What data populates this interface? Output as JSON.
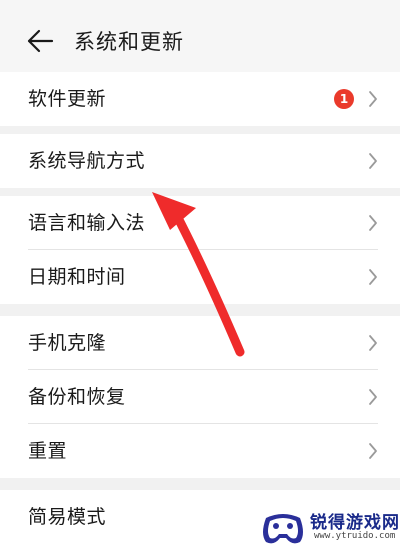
{
  "header": {
    "title": "系统和更新",
    "back_icon": "back-arrow-icon"
  },
  "groups": [
    {
      "items": [
        {
          "label": "软件更新",
          "badge": "1"
        }
      ]
    },
    {
      "items": [
        {
          "label": "系统导航方式"
        }
      ]
    },
    {
      "items": [
        {
          "label": "语言和输入法"
        },
        {
          "label": "日期和时间"
        }
      ]
    },
    {
      "items": [
        {
          "label": "手机克隆"
        },
        {
          "label": "备份和恢复"
        },
        {
          "label": "重置"
        }
      ]
    },
    {
      "items": [
        {
          "label": "简易模式"
        }
      ]
    }
  ],
  "annotation": {
    "color": "#ef2b2b"
  },
  "watermark": {
    "name": "锐得游戏网",
    "url": "www.ytruido.com"
  },
  "colors": {
    "badge": "#ea3a2b",
    "watermark_text": "#1a2a8a"
  }
}
